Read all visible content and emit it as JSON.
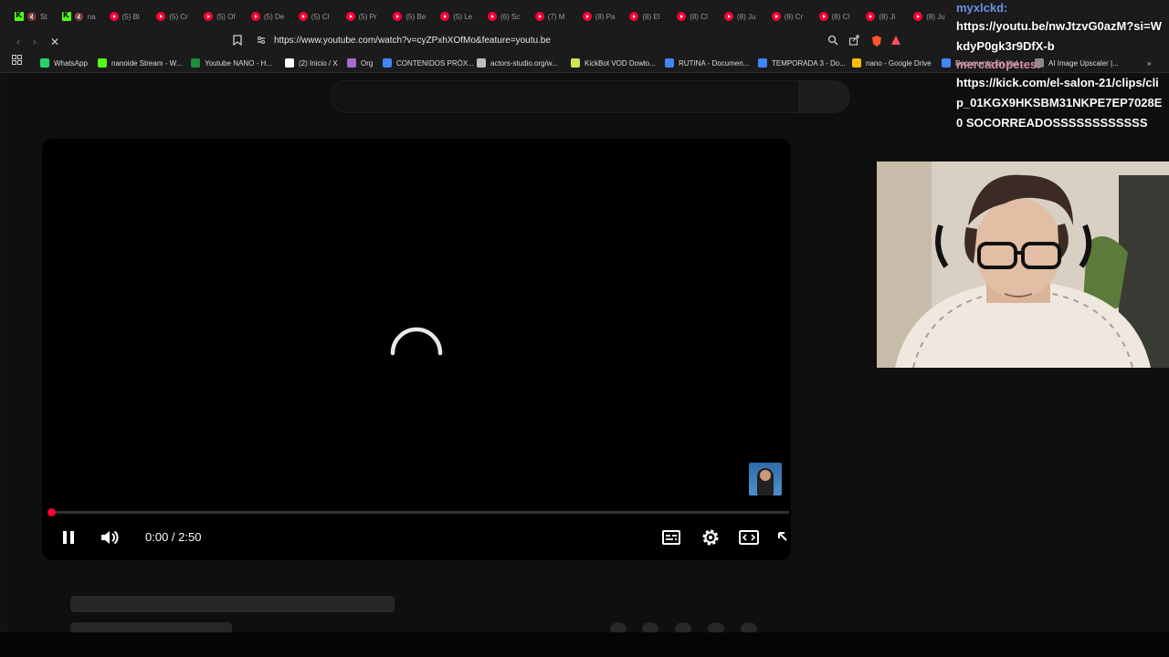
{
  "browser": {
    "tabs": [
      {
        "title": "St",
        "favicon": "kick",
        "muted": true
      },
      {
        "title": "na",
        "favicon": "kick",
        "muted": true
      },
      {
        "title": "(5) Bl",
        "favicon": "youtube"
      },
      {
        "title": "(5) Cr",
        "favicon": "youtube"
      },
      {
        "title": "(5) Of",
        "favicon": "youtube"
      },
      {
        "title": "(5) De",
        "favicon": "youtube"
      },
      {
        "title": "(5) Cl",
        "favicon": "youtube"
      },
      {
        "title": "(5) Pr",
        "favicon": "youtube"
      },
      {
        "title": "(5) Be",
        "favicon": "youtube"
      },
      {
        "title": "(5) Le",
        "favicon": "youtube"
      },
      {
        "title": "(6) Sc",
        "favicon": "youtube"
      },
      {
        "title": "(7) M",
        "favicon": "youtube"
      },
      {
        "title": "(8) Pa",
        "favicon": "youtube"
      },
      {
        "title": "(8) El",
        "favicon": "youtube"
      },
      {
        "title": "(8) Cl",
        "favicon": "youtube"
      },
      {
        "title": "(8) Ju",
        "favicon": "youtube"
      },
      {
        "title": "(8) Cr",
        "favicon": "youtube"
      },
      {
        "title": "(8) Cl",
        "favicon": "youtube"
      },
      {
        "title": "(8) Ji",
        "favicon": "youtube"
      },
      {
        "title": "(8) Ju",
        "favicon": "youtube"
      }
    ],
    "url": "https://www.youtube.com/watch?v=cyZPxhXOfMo&feature=youtu.be",
    "bookmarks": [
      {
        "label": "WhatsApp",
        "color": "#25d366"
      },
      {
        "label": "nanoide Stream - W...",
        "color": "#53fc18"
      },
      {
        "label": "Youtube NANO - H...",
        "color": "#1e8e3e"
      },
      {
        "label": "(2) Inicio / X",
        "color": "#ffffff"
      },
      {
        "label": "Org",
        "color": "#a86bc9"
      },
      {
        "label": "CONTENIDOS PRÓX...",
        "color": "#4285f4"
      },
      {
        "label": "actors-studio.org/w...",
        "color": "#bdbdbd"
      },
      {
        "label": "KickBot VOD Dowlo...",
        "color": "#d4e157"
      },
      {
        "label": "RUTINA - Documen...",
        "color": "#4285f4"
      },
      {
        "label": "TEMPORADA 3 - Do...",
        "color": "#4285f4"
      },
      {
        "label": "nano - Google Drive",
        "color": "#fbbc04"
      },
      {
        "label": "Documento sin títul...",
        "color": "#4285f4"
      },
      {
        "label": "AI Image Upscaler |...",
        "color": "#888888"
      }
    ]
  },
  "player": {
    "time_display": "0:00 / 2:50",
    "progress": 0.0,
    "accent_color": "#ff0033"
  },
  "chat": {
    "messages": [
      {
        "user": "myxlckd:",
        "text": "https://youtu.be/nwJtzvG0azM?si=WkdyP0gk3r9DfX-b"
      },
      {
        "user": "mercadopetes:",
        "text": "https://kick.com/el-salon-21/clips/clip_01KGX9HKSBM31NKPE7EP7028E0 SOCORREADOSSSSSSSSSSSS"
      }
    ]
  },
  "icons": {
    "back": "arrow-left-icon",
    "forward": "arrow-right-icon",
    "reload": "stop-loading-icon",
    "bookmark": "bookmark-icon",
    "pause": "pause-icon",
    "volume": "volume-icon",
    "captions": "captions-icon",
    "settings": "gear-icon",
    "theater": "theater-mode-icon",
    "miniplayer": "miniplayer-icon"
  }
}
